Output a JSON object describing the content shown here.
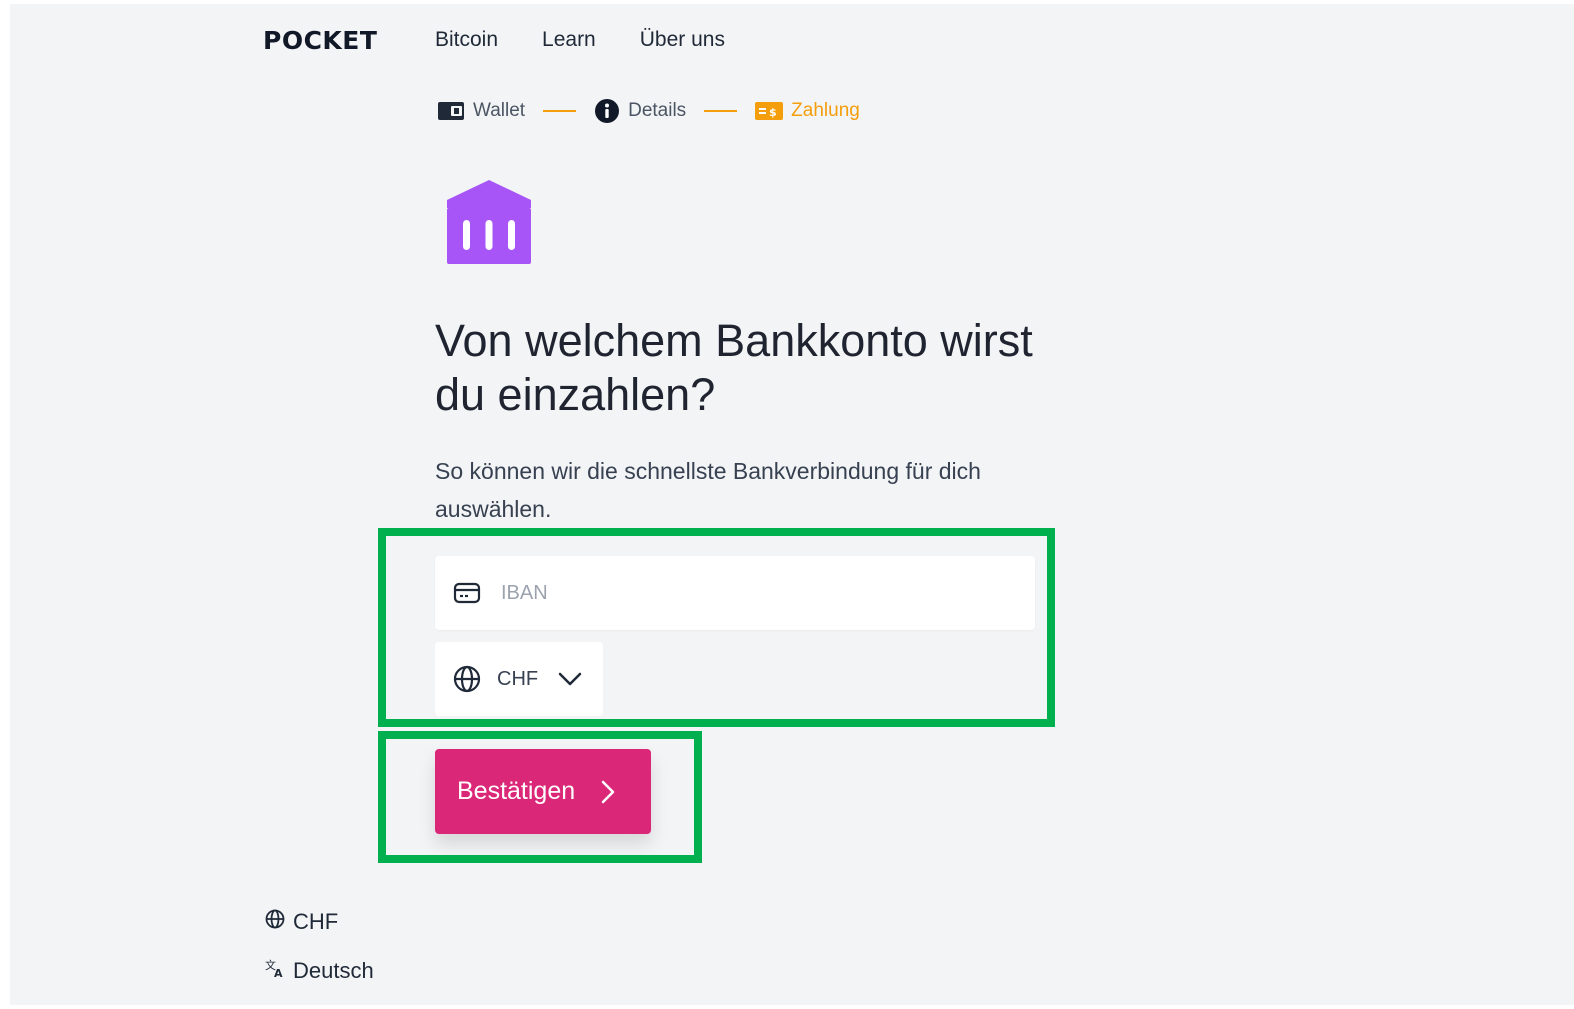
{
  "header": {
    "logo": "POCKET",
    "nav": [
      "Bitcoin",
      "Learn",
      "Über uns"
    ]
  },
  "steps": [
    {
      "label": "Wallet",
      "icon": "wallet-icon",
      "state": "done"
    },
    {
      "label": "Details",
      "icon": "info-icon",
      "state": "done"
    },
    {
      "label": "Zahlung",
      "icon": "payment-icon",
      "state": "active"
    }
  ],
  "main": {
    "icon": "bank-icon",
    "title": "Von welchem Bankkonto wirst du einzahlen?",
    "subtitle": "So können wir die schnellste Bankverbindung für dich auswählen.",
    "iban": {
      "placeholder": "IBAN",
      "value": ""
    },
    "currency": {
      "selected": "CHF"
    },
    "confirm_label": "Bestätigen"
  },
  "footer": {
    "currency": "CHF",
    "language": "Deutsch"
  },
  "colors": {
    "accent": "#db2777",
    "step_active": "#f59e0b",
    "bank_icon": "#a855f7",
    "highlight": "#00b04f",
    "background": "#f3f4f6"
  }
}
